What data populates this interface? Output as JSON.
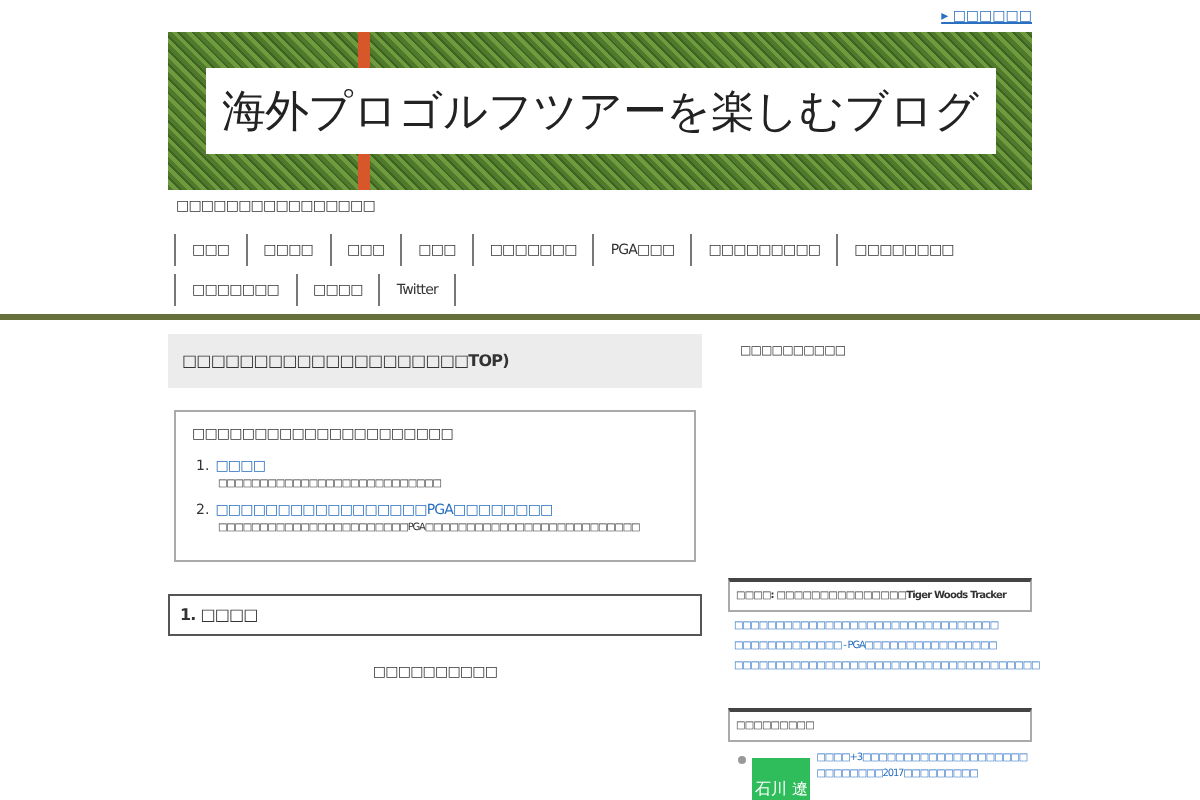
{
  "top_link": "▸ □□□□□□",
  "banner": {
    "title": "海外プロゴルフツアーを楽しむブログ"
  },
  "tagline": "□□□□□□□□□□□□□□□□",
  "nav": [
    "□□□",
    "□□□□",
    "□□□",
    "□□□",
    "□□□□□□□",
    "PGA□□□",
    "□□□□□□□□□",
    "□□□□□□□□",
    "□□□□□□□",
    "□□□□",
    "Twitter"
  ],
  "page_title": "□□□□□□□□□□□□□□□□□□□□TOP)",
  "toc": {
    "title": "□□□□□□□□□□□□□□□□□□□□□",
    "items": [
      {
        "number": "1.",
        "link": "□□□□",
        "description": "□□□□□□□□□□□□□□□□□□□□□□□□□□□"
      },
      {
        "number": "2.",
        "link": "□□□□□□□□□□□□□□□□□PGA□□□□□□□□",
        "description": "□□□□□□□□□□□□□□□□□□□□□□□PGA□□□□□□□□□□□□□□□□□□□□□□□□□□"
      }
    ]
  },
  "section": {
    "number": "1.",
    "title": "□□□□"
  },
  "section_text": "□□□□□□□□□□",
  "sidebar": {
    "heading": "□□□□□□□□□□",
    "widget1": {
      "title": "□□□□: □□□□□□□□□□□□□□□Tiger Woods Tracker",
      "links": [
        "□□□□□□□□□□□□□□□□□□□□□□□□□□□□□□□□",
        "□□□□□□□□□□□□□ - PGA□□□□□□□□□□□□□□□□",
        "□□□□□□□□□□□□□□□□□□□□□□□□□□□□□□□□□□□□□"
      ]
    },
    "widget2": {
      "title": "□□□□□□□□□",
      "post": {
        "thumb_text": "石川 遼",
        "link": "□□□□+3□□□□□□□□□□□□□□□□□□□□□□□□□□□□2017□□□□□□□□□"
      }
    }
  }
}
